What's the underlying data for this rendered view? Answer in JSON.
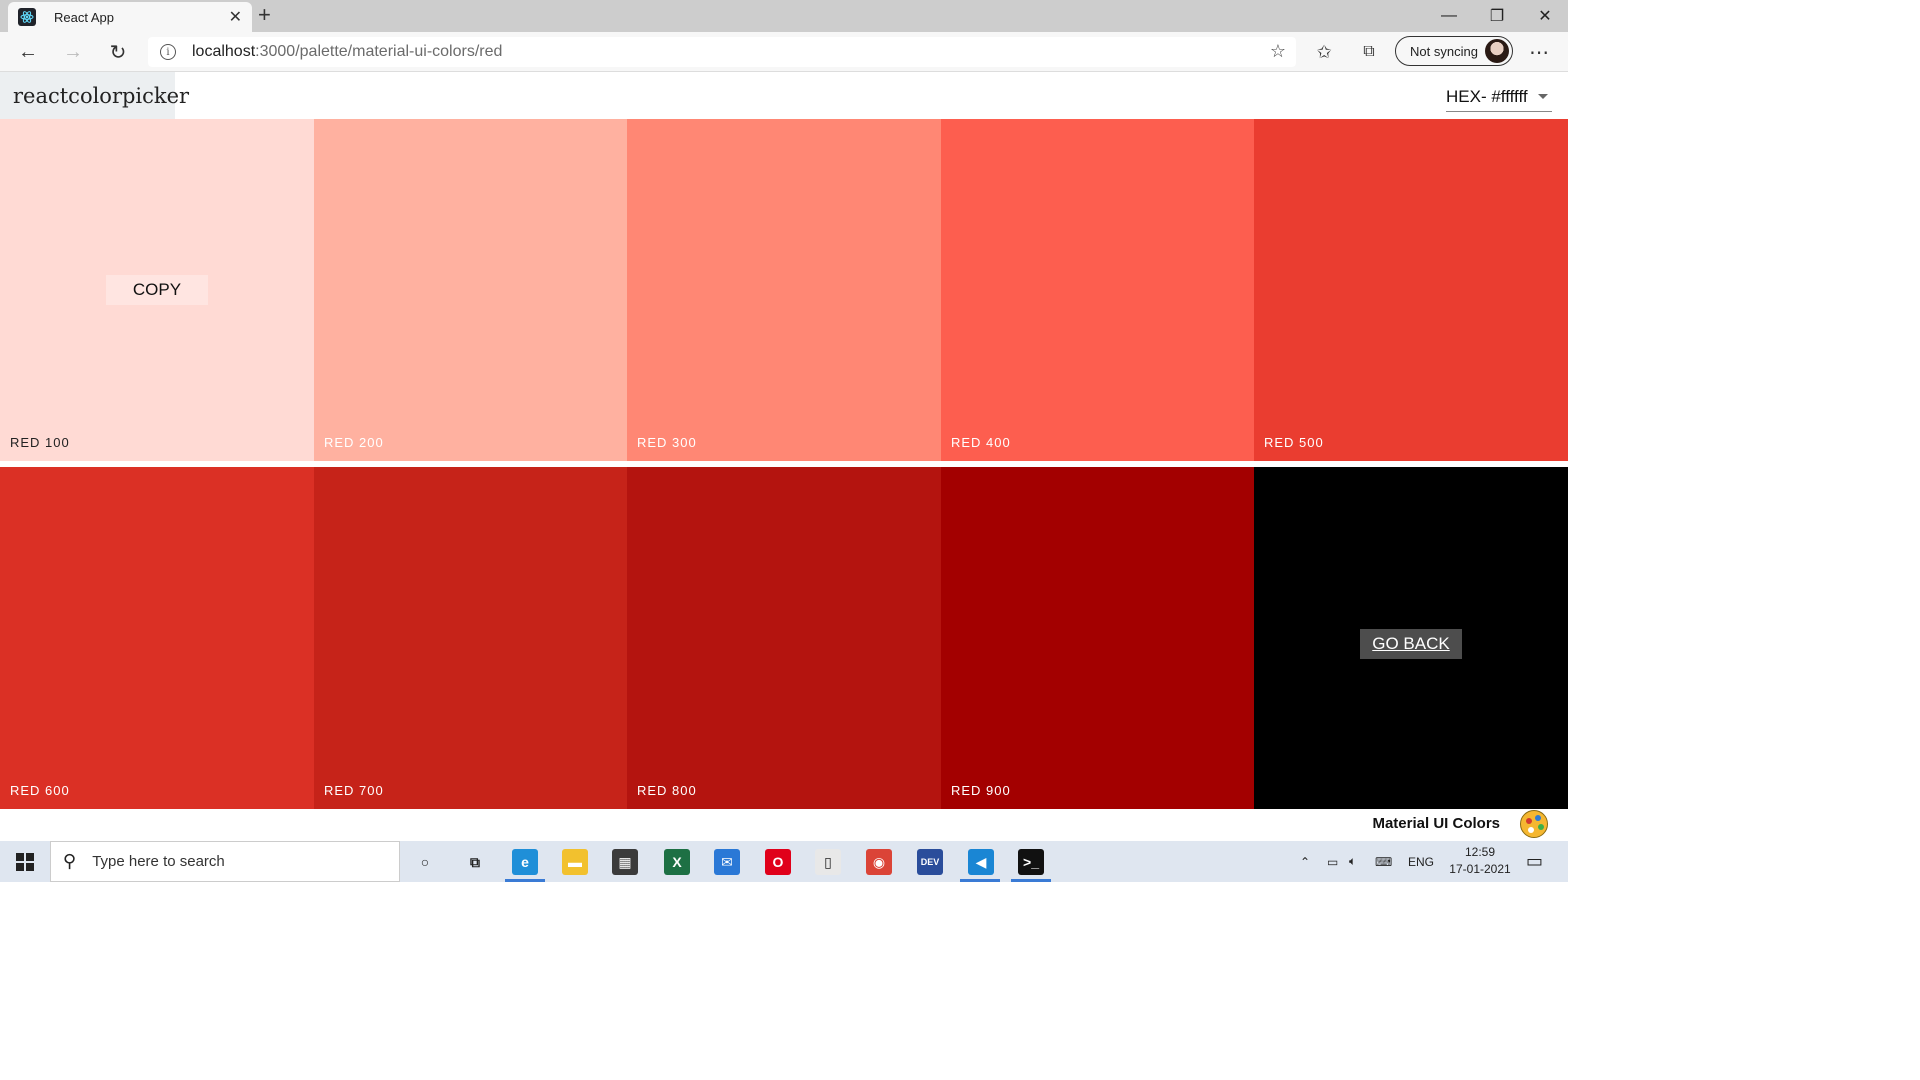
{
  "browser": {
    "tab_title": "React App",
    "tab_close": "✕",
    "new_tab": "+",
    "url_host": "localhost",
    "url_path": ":3000/palette/material-ui-colors/red",
    "sync_label": "Not syncing",
    "window_controls": [
      "—",
      "❐",
      "✕"
    ]
  },
  "app": {
    "logo": "reactcolorpicker",
    "format_label": "HEX- #ffffff",
    "copy_label": "COPY",
    "go_back_label": "GO BACK",
    "palette_name": "Material UI Colors",
    "colors": [
      {
        "name": "RED 100",
        "hex": "#ffdad4",
        "text": "#222222"
      },
      {
        "name": "RED 200",
        "hex": "#ffb1a0",
        "text": "#ffffff"
      },
      {
        "name": "RED 300",
        "hex": "#ff8774",
        "text": "#ffffff"
      },
      {
        "name": "RED 400",
        "hex": "#fd5e4f",
        "text": "#ffffff"
      },
      {
        "name": "RED 500",
        "hex": "#ea3d30",
        "text": "#ffffff"
      },
      {
        "name": "RED 600",
        "hex": "#db3025",
        "text": "#ffffff"
      },
      {
        "name": "RED 700",
        "hex": "#c62319",
        "text": "#ffffff"
      },
      {
        "name": "RED 800",
        "hex": "#b4140f",
        "text": "#ffffff"
      },
      {
        "name": "RED 900",
        "hex": "#a30000",
        "text": "#ffffff"
      }
    ]
  },
  "taskbar": {
    "search_placeholder": "Type here to search",
    "language": "ENG",
    "time": "12:59",
    "date": "17-01-2021",
    "apps": [
      {
        "icon": "cortana-icon",
        "glyph": "○",
        "color": "transparent"
      },
      {
        "icon": "task-view-icon",
        "glyph": "⧉",
        "color": "transparent"
      },
      {
        "icon": "edge-icon",
        "glyph": "e",
        "color": "#1f8fd8"
      },
      {
        "icon": "file-explorer-icon",
        "glyph": "▬",
        "color": "#f2c12e"
      },
      {
        "icon": "store-icon",
        "glyph": "▦",
        "color": "#3b3b3b"
      },
      {
        "icon": "excel-icon",
        "glyph": "X",
        "color": "#1d7044"
      },
      {
        "icon": "mail-icon",
        "glyph": "✉",
        "color": "#2a78d6"
      },
      {
        "icon": "opera-icon",
        "glyph": "O",
        "color": "#e0001a"
      },
      {
        "icon": "notepad-icon",
        "glyph": "▯",
        "color": "#e8e8e8"
      },
      {
        "icon": "chrome-icon",
        "glyph": "◉",
        "color": "#db4437"
      },
      {
        "icon": "dev-icon",
        "glyph": "DEV",
        "color": "#2a4d9b"
      },
      {
        "icon": "vscode-icon",
        "glyph": "◀",
        "color": "#1a86d4"
      },
      {
        "icon": "terminal-icon",
        "glyph": ">_",
        "color": "#111111"
      }
    ]
  }
}
